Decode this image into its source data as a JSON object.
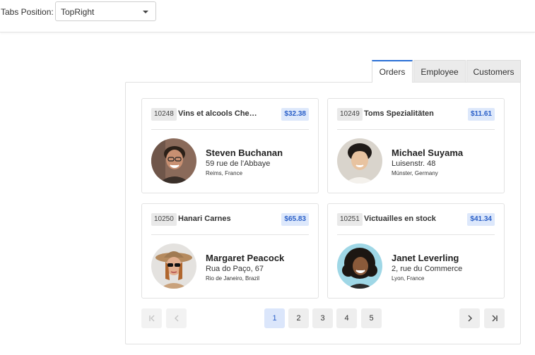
{
  "toolbar": {
    "tabs_position_label": "Tabs Position:",
    "tabs_position_value": "TopRight"
  },
  "tabs": [
    {
      "label": "Orders",
      "active": true
    },
    {
      "label": "Employee",
      "active": false
    },
    {
      "label": "Customers",
      "active": false
    }
  ],
  "orders": [
    {
      "id": "10248",
      "ship_name": "Vins et alcools Che…",
      "price": "$32.38",
      "employee": "Steven Buchanan",
      "address": "59 rue de l'Abbaye",
      "city": "Reims, France",
      "avatar": "man-glasses-avatar"
    },
    {
      "id": "10249",
      "ship_name": "Toms Spezialitäten",
      "price": "$11.61",
      "employee": "Michael Suyama",
      "address": "Luisenstr. 48",
      "city": "Münster, Germany",
      "avatar": "young-man-avatar"
    },
    {
      "id": "10250",
      "ship_name": "Hanari Carnes",
      "price": "$65.83",
      "employee": "Margaret Peacock",
      "address": "Rua do Paço, 67",
      "city": "Rio de Janeiro, Brazil",
      "avatar": "woman-hat-avatar"
    },
    {
      "id": "10251",
      "ship_name": "Victuailles en stock",
      "price": "$41.34",
      "employee": "Janet Leverling",
      "address": "2, rue du Commerce",
      "city": "Lyon, France",
      "avatar": "woman-curly-hair-avatar"
    }
  ],
  "pager": {
    "first_icon": "first-page-icon",
    "prev_icon": "prev-page-icon",
    "next_icon": "next-page-icon",
    "last_icon": "last-page-icon",
    "pages": [
      "1",
      "2",
      "3",
      "4",
      "5"
    ],
    "current_page": "1"
  },
  "colors": {
    "accent": "#2a6fd6",
    "price_bg": "#dde8fb",
    "price_text": "#2a5fc8"
  }
}
